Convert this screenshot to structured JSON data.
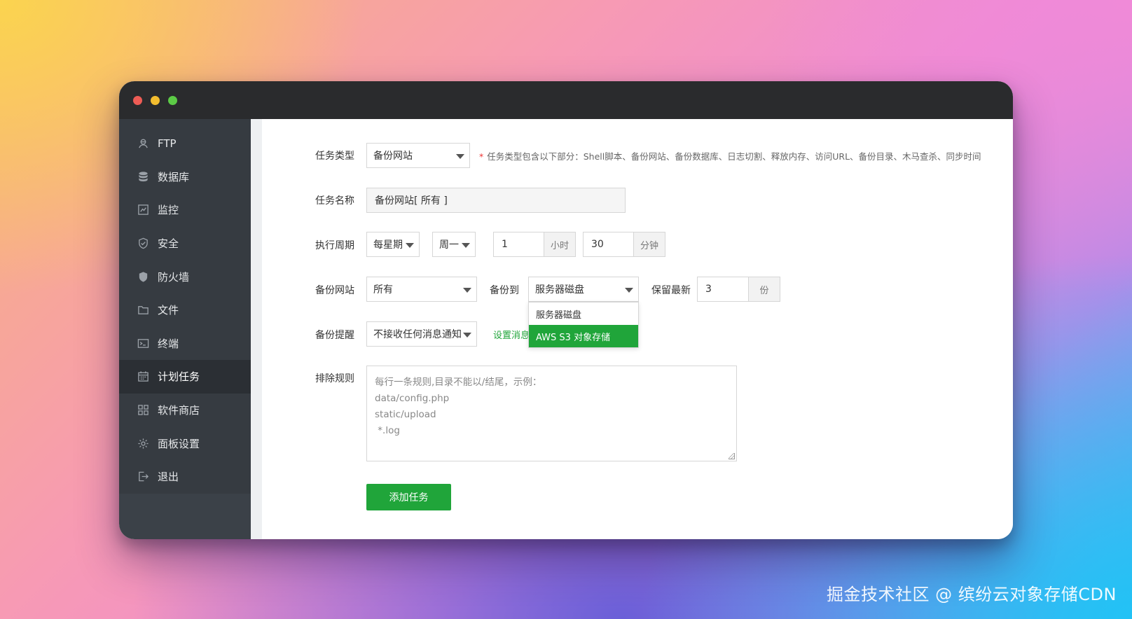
{
  "sidebar": {
    "items": [
      {
        "label": "FTP",
        "icon": "ftp-icon",
        "active": false
      },
      {
        "label": "数据库",
        "icon": "database-icon",
        "active": false
      },
      {
        "label": "监控",
        "icon": "monitor-icon",
        "active": false
      },
      {
        "label": "安全",
        "icon": "shield-icon",
        "active": false
      },
      {
        "label": "防火墙",
        "icon": "firewall-icon",
        "active": false
      },
      {
        "label": "文件",
        "icon": "folder-icon",
        "active": false
      },
      {
        "label": "终端",
        "icon": "terminal-icon",
        "active": false
      },
      {
        "label": "计划任务",
        "icon": "calendar-icon",
        "active": true
      },
      {
        "label": "软件商店",
        "icon": "apps-icon",
        "active": false
      },
      {
        "label": "面板设置",
        "icon": "gear-icon",
        "active": false
      },
      {
        "label": "退出",
        "icon": "logout-icon",
        "active": false
      }
    ]
  },
  "form": {
    "task_type": {
      "label": "任务类型",
      "value": "备份网站",
      "hint_star": "*",
      "hint": "任务类型包含以下部分：Shell脚本、备份网站、备份数据库、日志切割、释放内存、访问URL、备份目录、木马查杀、同步时间"
    },
    "task_name": {
      "label": "任务名称",
      "value": "备份网站[ 所有 ]"
    },
    "period": {
      "label": "执行周期",
      "cycle": "每星期",
      "weekday": "周一",
      "hour": "1",
      "hour_unit": "小时",
      "minute": "30",
      "minute_unit": "分钟"
    },
    "backup_site": {
      "label": "备份网站",
      "value": "所有",
      "target_label": "备份到",
      "target_value": "服务器磁盘",
      "target_options": [
        "服务器磁盘",
        "AWS S3 对象存储"
      ],
      "target_highlighted": "AWS S3 对象存储",
      "keep_label": "保留最新",
      "keep_value": "3",
      "keep_unit": "份"
    },
    "notify": {
      "label": "备份提醒",
      "value": "不接收任何消息通知",
      "link": "设置消息"
    },
    "exclude": {
      "label": "排除规则",
      "placeholder_lines": [
        "每行一条规则,目录不能以/结尾，示例：",
        "data/config.php",
        "static/upload",
        " *.log"
      ]
    },
    "submit_label": "添加任务"
  },
  "watermark": "掘金技术社区 @ 缤纷云对象存储CDN",
  "colors": {
    "accent": "#20a53a",
    "sidebar": "#3b4148",
    "titlebar": "#2a2b2d"
  }
}
